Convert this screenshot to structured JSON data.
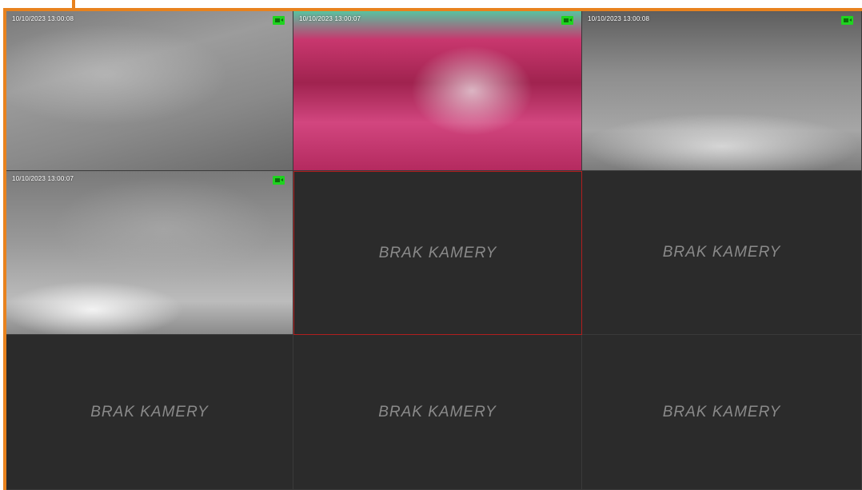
{
  "tiles": [
    {
      "timestamp": "10/10/2023  13:00:08",
      "status_icon": "camera-recording-icon",
      "feed": "grayscale-ceiling"
    },
    {
      "timestamp": "10/10/2023  13:00:07",
      "status_icon": "camera-recording-icon",
      "feed": "pink-tinted-room"
    },
    {
      "timestamp": "10/10/2023  13:00:08",
      "status_icon": "camera-recording-icon",
      "feed": "grayscale-wall"
    },
    {
      "timestamp": "10/10/2023  13:00:07",
      "status_icon": "camera-recording-icon",
      "feed": "grayscale-blur"
    },
    {
      "placeholder": "BRAK KAMERY",
      "selected": true
    },
    {
      "placeholder": "BRAK KAMERY"
    },
    {
      "placeholder": "BRAK KAMERY"
    },
    {
      "placeholder": "BRAK KAMERY"
    },
    {
      "placeholder": "BRAK KAMERY"
    }
  ],
  "colors": {
    "frame_accent": "#e8821e",
    "recording_indicator": "#1fd41f",
    "selected_border": "#b01e1e",
    "empty_tile_bg": "#2b2b2b",
    "placeholder_text": "#8a8a8a"
  }
}
